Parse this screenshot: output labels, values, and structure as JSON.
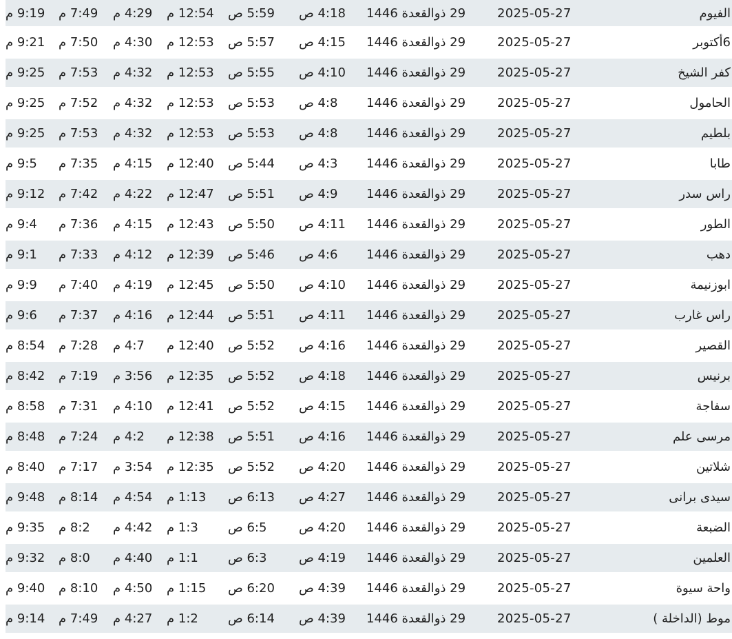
{
  "rows": [
    {
      "city": "الفيوم",
      "gregorian": "2025-05-27",
      "hijri": "29 ذوالقعدة 1446",
      "fajr": "4:18 ص",
      "sunrise": "5:59 ص",
      "dhuhr": "12:54 م",
      "asr": "4:29 م",
      "maghrib": "7:49 م",
      "isha": "9:19 م"
    },
    {
      "city": "6أكتوبر",
      "gregorian": "2025-05-27",
      "hijri": "29 ذوالقعدة 1446",
      "fajr": "4:15 ص",
      "sunrise": "5:57 ص",
      "dhuhr": "12:53 م",
      "asr": "4:30 م",
      "maghrib": "7:50 م",
      "isha": "9:21 م"
    },
    {
      "city": "كفر الشيخ",
      "gregorian": "2025-05-27",
      "hijri": "29 ذوالقعدة 1446",
      "fajr": "4:10 ص",
      "sunrise": "5:55 ص",
      "dhuhr": "12:53 م",
      "asr": "4:32 م",
      "maghrib": "7:53 م",
      "isha": "9:25 م"
    },
    {
      "city": "الحامول",
      "gregorian": "2025-05-27",
      "hijri": "29 ذوالقعدة 1446",
      "fajr": "4:8 ص",
      "sunrise": "5:53 ص",
      "dhuhr": "12:53 م",
      "asr": "4:32 م",
      "maghrib": "7:52 م",
      "isha": "9:25 م"
    },
    {
      "city": "بلطيم",
      "gregorian": "2025-05-27",
      "hijri": "29 ذوالقعدة 1446",
      "fajr": "4:8 ص",
      "sunrise": "5:53 ص",
      "dhuhr": "12:53 م",
      "asr": "4:32 م",
      "maghrib": "7:53 م",
      "isha": "9:25 م"
    },
    {
      "city": "طابا",
      "gregorian": "2025-05-27",
      "hijri": "29 ذوالقعدة 1446",
      "fajr": "4:3 ص",
      "sunrise": "5:44 ص",
      "dhuhr": "12:40 م",
      "asr": "4:15 م",
      "maghrib": "7:35 م",
      "isha": "9:5 م"
    },
    {
      "city": "راس سدر",
      "gregorian": "2025-05-27",
      "hijri": "29 ذوالقعدة 1446",
      "fajr": "4:9 ص",
      "sunrise": "5:51 ص",
      "dhuhr": "12:47 م",
      "asr": "4:22 م",
      "maghrib": "7:42 م",
      "isha": "9:12 م"
    },
    {
      "city": "الطور",
      "gregorian": "2025-05-27",
      "hijri": "29 ذوالقعدة 1446",
      "fajr": "4:11 ص",
      "sunrise": "5:50 ص",
      "dhuhr": "12:43 م",
      "asr": "4:15 م",
      "maghrib": "7:36 م",
      "isha": "9:4 م"
    },
    {
      "city": "دهب",
      "gregorian": "2025-05-27",
      "hijri": "29 ذوالقعدة 1446",
      "fajr": "4:6 ص",
      "sunrise": "5:46 ص",
      "dhuhr": "12:39 م",
      "asr": "4:12 م",
      "maghrib": "7:33 م",
      "isha": "9:1 م"
    },
    {
      "city": "ابوزنيمة",
      "gregorian": "2025-05-27",
      "hijri": "29 ذوالقعدة 1446",
      "fajr": "4:10 ص",
      "sunrise": "5:50 ص",
      "dhuhr": "12:45 م",
      "asr": "4:19 م",
      "maghrib": "7:40 م",
      "isha": "9:9 م"
    },
    {
      "city": "راس غارب",
      "gregorian": "2025-05-27",
      "hijri": "29 ذوالقعدة 1446",
      "fajr": "4:11 ص",
      "sunrise": "5:51 ص",
      "dhuhr": "12:44 م",
      "asr": "4:16 م",
      "maghrib": "7:37 م",
      "isha": "9:6 م"
    },
    {
      "city": "القصير",
      "gregorian": "2025-05-27",
      "hijri": "29 ذوالقعدة 1446",
      "fajr": "4:16 ص",
      "sunrise": "5:52 ص",
      "dhuhr": "12:40 م",
      "asr": "4:7 م",
      "maghrib": "7:28 م",
      "isha": "8:54 م"
    },
    {
      "city": "برنيس",
      "gregorian": "2025-05-27",
      "hijri": "29 ذوالقعدة 1446",
      "fajr": "4:18 ص",
      "sunrise": "5:52 ص",
      "dhuhr": "12:35 م",
      "asr": "3:56 م",
      "maghrib": "7:19 م",
      "isha": "8:42 م"
    },
    {
      "city": "سفاجة",
      "gregorian": "2025-05-27",
      "hijri": "29 ذوالقعدة 1446",
      "fajr": "4:15 ص",
      "sunrise": "5:52 ص",
      "dhuhr": "12:41 م",
      "asr": "4:10 م",
      "maghrib": "7:31 م",
      "isha": "8:58 م"
    },
    {
      "city": "مرسى علم",
      "gregorian": "2025-05-27",
      "hijri": "29 ذوالقعدة 1446",
      "fajr": "4:16 ص",
      "sunrise": "5:51 ص",
      "dhuhr": "12:38 م",
      "asr": "4:2 م",
      "maghrib": "7:24 م",
      "isha": "8:48 م"
    },
    {
      "city": "شلاتين",
      "gregorian": "2025-05-27",
      "hijri": "29 ذوالقعدة 1446",
      "fajr": "4:20 ص",
      "sunrise": "5:52 ص",
      "dhuhr": "12:35 م",
      "asr": "3:54 م",
      "maghrib": "7:17 م",
      "isha": "8:40 م"
    },
    {
      "city": "سيدى برانى",
      "gregorian": "2025-05-27",
      "hijri": "29 ذوالقعدة 1446",
      "fajr": "4:27 ص",
      "sunrise": "6:13 ص",
      "dhuhr": "1:13 م",
      "asr": "4:54 م",
      "maghrib": "8:14 م",
      "isha": "9:48 م"
    },
    {
      "city": "الضبعة",
      "gregorian": "2025-05-27",
      "hijri": "29 ذوالقعدة 1446",
      "fajr": "4:20 ص",
      "sunrise": "6:5 ص",
      "dhuhr": "1:3 م",
      "asr": "4:42 م",
      "maghrib": "8:2 م",
      "isha": "9:35 م"
    },
    {
      "city": "العلمين",
      "gregorian": "2025-05-27",
      "hijri": "29 ذوالقعدة 1446",
      "fajr": "4:19 ص",
      "sunrise": "6:3 ص",
      "dhuhr": "1:1 م",
      "asr": "4:40 م",
      "maghrib": "8:0 م",
      "isha": "9:32 م"
    },
    {
      "city": "واحة سيوة",
      "gregorian": "2025-05-27",
      "hijri": "29 ذوالقعدة 1446",
      "fajr": "4:39 ص",
      "sunrise": "6:20 ص",
      "dhuhr": "1:15 م",
      "asr": "4:50 م",
      "maghrib": "8:10 م",
      "isha": "9:40 م"
    },
    {
      "city": "موط (الداخلة )",
      "gregorian": "2025-05-27",
      "hijri": "29 ذوالقعدة 1446",
      "fajr": "4:39 ص",
      "sunrise": "6:14 ص",
      "dhuhr": "1:2 م",
      "asr": "4:27 م",
      "maghrib": "7:49 م",
      "isha": "9:14 م"
    }
  ],
  "colors": {
    "row_shade": "#e6ebee",
    "row_plain": "#ffffff",
    "text": "#1f1f1f"
  }
}
